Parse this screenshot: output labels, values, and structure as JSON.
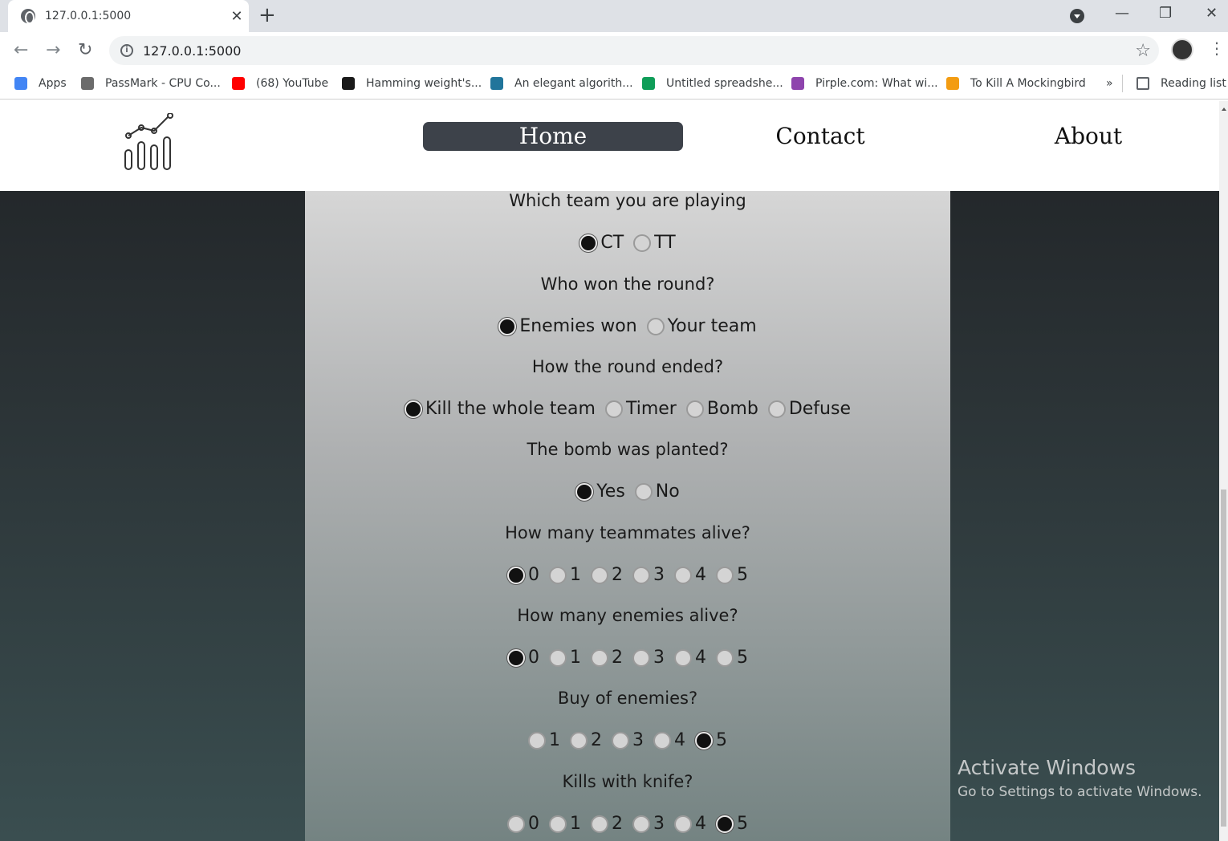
{
  "browser": {
    "tab_title": "127.0.0.1:5000",
    "tab_close": "✕",
    "new_tab": "+",
    "url": "127.0.0.1:5000",
    "minimize": "—",
    "maximize": "❐",
    "close": "✕"
  },
  "bookmarks": [
    {
      "label": "Apps",
      "color": "#4285f4"
    },
    {
      "label": "PassMark - CPU Co...",
      "color": "#6b6b6b"
    },
    {
      "label": "(68) YouTube",
      "color": "#ff0000"
    },
    {
      "label": "Hamming weight's...",
      "color": "#1a1a1a"
    },
    {
      "label": "An elegant algorith...",
      "color": "#21759b"
    },
    {
      "label": "Untitled spreadshe...",
      "color": "#0f9d58"
    },
    {
      "label": "Pirple.com: What wi...",
      "color": "#8e44ad"
    },
    {
      "label": "To Kill A Mockingbird",
      "color": "#f39c12"
    }
  ],
  "bookmarks_more": "»",
  "reading_list": "Reading list",
  "nav": {
    "home": "Home",
    "contact": "Contact",
    "about": "About"
  },
  "form": {
    "questions": [
      {
        "label": "Which team you are playing",
        "options": [
          "CT",
          "TT"
        ],
        "selected": 0
      },
      {
        "label": "Who won the round?",
        "options": [
          "Enemies won",
          "Your team"
        ],
        "selected": 0
      },
      {
        "label": "How the round ended?",
        "options": [
          "Kill the whole team",
          "Timer",
          "Bomb",
          "Defuse"
        ],
        "selected": 0
      },
      {
        "label": "The bomb was planted?",
        "options": [
          "Yes",
          "No"
        ],
        "selected": 0
      },
      {
        "label": "How many teammates alive?",
        "options": [
          "0",
          "1",
          "2",
          "3",
          "4",
          "5"
        ],
        "selected": 0
      },
      {
        "label": "How many enemies alive?",
        "options": [
          "0",
          "1",
          "2",
          "3",
          "4",
          "5"
        ],
        "selected": 0
      },
      {
        "label": "Buy of enemies?",
        "options": [
          "1",
          "2",
          "3",
          "4",
          "5"
        ],
        "selected": 4
      },
      {
        "label": "Kills with knife?",
        "options": [
          "0",
          "1",
          "2",
          "3",
          "4",
          "5"
        ],
        "selected": 5
      }
    ]
  },
  "watermark": {
    "title": "Activate Windows",
    "subtitle": "Go to Settings to activate Windows."
  }
}
